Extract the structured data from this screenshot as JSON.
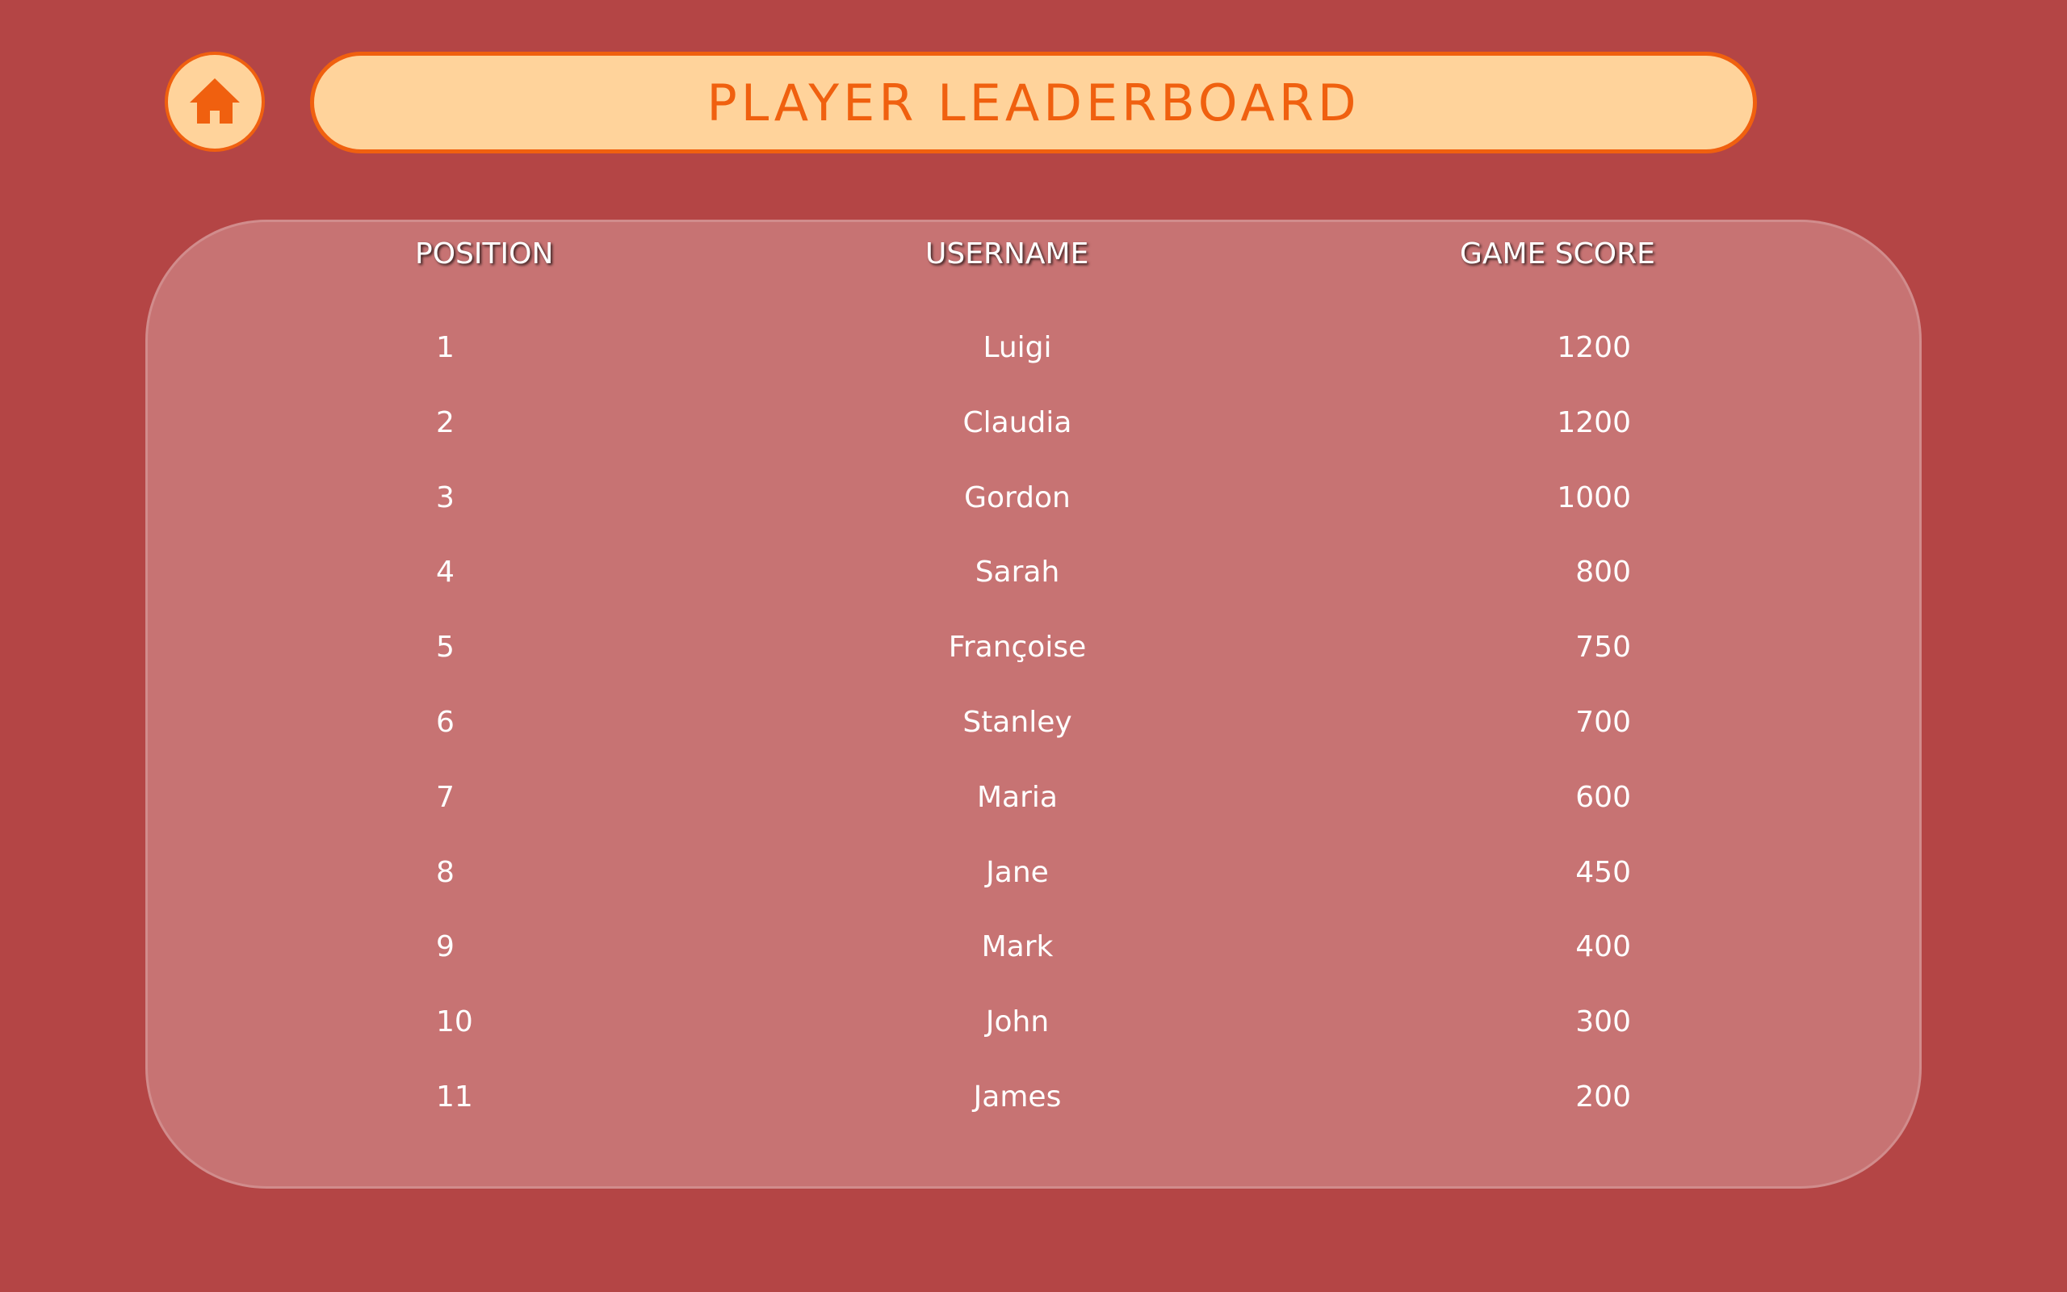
{
  "colors": {
    "background": "#b44545",
    "accent": "#f0600f",
    "title_fill": "#ffd39b",
    "text": "#ffffff"
  },
  "home": {
    "icon": "home-icon"
  },
  "header": {
    "title": "PLAYER LEADERBOARD"
  },
  "table": {
    "columns": [
      "POSITION",
      "USERNAME",
      "GAME SCORE"
    ],
    "rows": [
      {
        "position": "1",
        "username": "Luigi",
        "score": "1200"
      },
      {
        "position": "2",
        "username": "Claudia",
        "score": "1200"
      },
      {
        "position": "3",
        "username": "Gordon",
        "score": "1000"
      },
      {
        "position": "4",
        "username": "Sarah",
        "score": "800"
      },
      {
        "position": "5",
        "username": "Françoise",
        "score": "750"
      },
      {
        "position": "6",
        "username": "Stanley",
        "score": "700"
      },
      {
        "position": "7",
        "username": "Maria",
        "score": "600"
      },
      {
        "position": "8",
        "username": "Jane",
        "score": "450"
      },
      {
        "position": "9",
        "username": "Mark",
        "score": "400"
      },
      {
        "position": "10",
        "username": "John",
        "score": "300"
      },
      {
        "position": "11",
        "username": "James",
        "score": "200"
      }
    ]
  }
}
